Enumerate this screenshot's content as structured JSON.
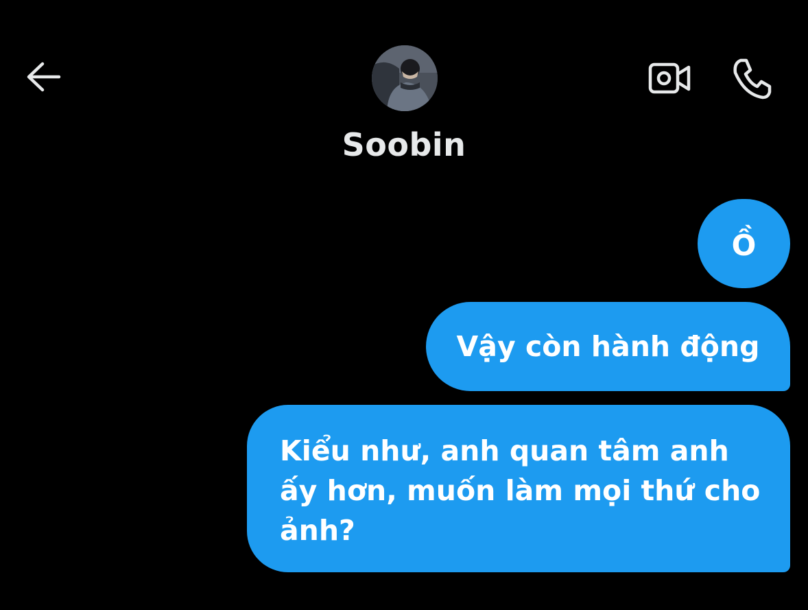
{
  "header": {
    "contact_name": "Soobin",
    "back_icon": "arrow-left-icon",
    "video_icon": "video-camera-icon",
    "call_icon": "phone-icon"
  },
  "messages": [
    {
      "sender": "me",
      "lines": [
        "Ồ"
      ]
    },
    {
      "sender": "me",
      "lines": [
        "Vậy còn hành động"
      ]
    },
    {
      "sender": "me",
      "lines": [
        "Kiểu như, anh quan tâm anh",
        "ấy hơn, muốn làm mọi thứ cho",
        "ảnh?"
      ]
    }
  ],
  "colors": {
    "background": "#000000",
    "bubble": "#1d9bf0",
    "text": "#ffffff",
    "icon": "#e7e9ea"
  }
}
